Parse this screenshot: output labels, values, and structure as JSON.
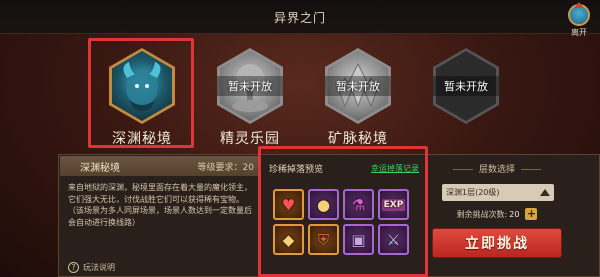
{
  "title": "异界之门",
  "exit": {
    "label": "离开",
    "icon": "house-exit-icon"
  },
  "realms": [
    {
      "name": "深渊秘境",
      "locked": false,
      "lock_text": ""
    },
    {
      "name": "精灵乐园",
      "locked": true,
      "lock_text": "暂未开放"
    },
    {
      "name": "矿脉秘境",
      "locked": true,
      "lock_text": "暂未开放"
    },
    {
      "name": "",
      "locked": true,
      "lock_text": "暂未开放"
    }
  ],
  "detail": {
    "name": "深渊秘境",
    "level_req_label": "等级要求：",
    "level_req_value": "20",
    "description": "来自地狱的深渊，秘境里面存在着大量的魔化领主，它们强大无比，讨伐战胜它们可以获得稀有宝物。\n（该场景为多人同屏场景，场景人数达到一定数量后会自动进行换线路）",
    "help_label": "玩法说明"
  },
  "loot": {
    "title": "珍稀掉落预览",
    "record_link": "幸运掉落记录",
    "items": [
      {
        "icon": "heart-icon",
        "rarity": "orange"
      },
      {
        "icon": "gold-coins-icon",
        "rarity": "purple"
      },
      {
        "icon": "potion-icon",
        "rarity": "purple"
      },
      {
        "icon": "exp-scroll-icon",
        "rarity": "purple",
        "text": "EXP"
      },
      {
        "icon": "gold-pile-icon",
        "rarity": "orange"
      },
      {
        "icon": "armor-icon",
        "rarity": "orange"
      },
      {
        "icon": "book-icon",
        "rarity": "purple"
      },
      {
        "icon": "weapon-icon",
        "rarity": "purple"
      }
    ]
  },
  "floor": {
    "label": "层数选择",
    "selected": "深渊1层(20级)",
    "remaining_label": "剩余挑战次数:",
    "remaining_value": "20",
    "challenge_button": "立即挑战"
  },
  "colors": {
    "highlight": "#e03535",
    "accent_green": "#3bd16a",
    "challenge_red": "#d23a30"
  }
}
